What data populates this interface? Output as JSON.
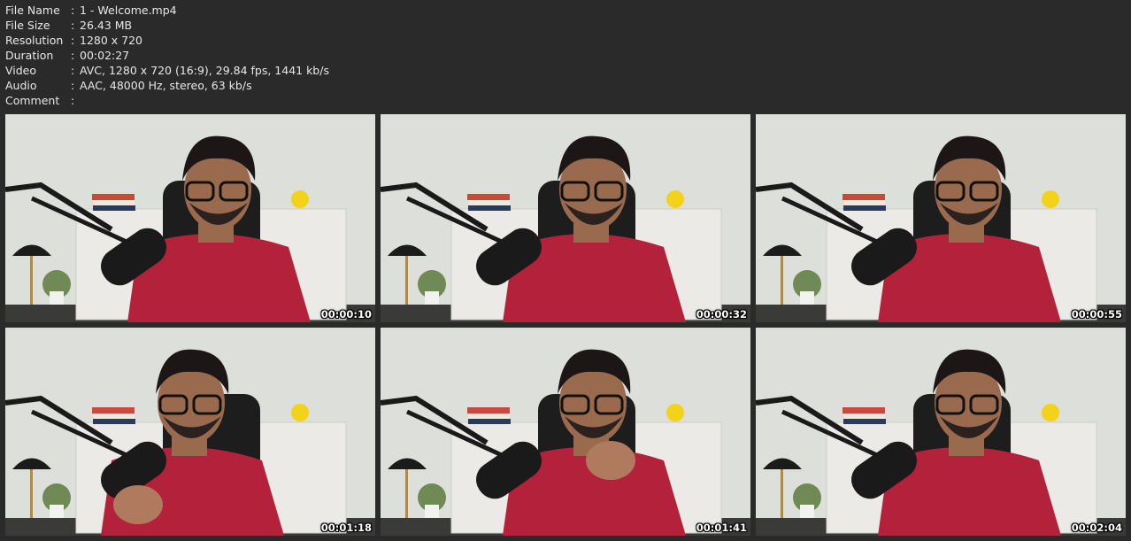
{
  "info": {
    "separator": ":",
    "rows": [
      {
        "key": "File Name",
        "value": "1 - Welcome.mp4"
      },
      {
        "key": "File Size",
        "value": "26.43 MB"
      },
      {
        "key": "Resolution",
        "value": "1280 x 720"
      },
      {
        "key": "Duration",
        "value": "00:02:27"
      },
      {
        "key": "Video",
        "value": "AVC, 1280 x 720 (16:9), 29.84 fps, 1441 kb/s"
      },
      {
        "key": "Audio",
        "value": "AAC, 48000 Hz, stereo, 63 kb/s"
      },
      {
        "key": "Comment",
        "value": ""
      }
    ]
  },
  "thumbnails": [
    {
      "timestamp": "00:00:10"
    },
    {
      "timestamp": "00:00:32"
    },
    {
      "timestamp": "00:00:55"
    },
    {
      "timestamp": "00:01:18"
    },
    {
      "timestamp": "00:01:41"
    },
    {
      "timestamp": "00:02:04"
    }
  ],
  "colors": {
    "background": "#2a2a2a",
    "wall": "#dcdfda",
    "shirt": "#b3213a",
    "skin": "#9a6a4e",
    "hair": "#1c1716",
    "mic": "#1a1a1a",
    "smiley": "#f2d21a",
    "cabinet": "#eceae6"
  }
}
